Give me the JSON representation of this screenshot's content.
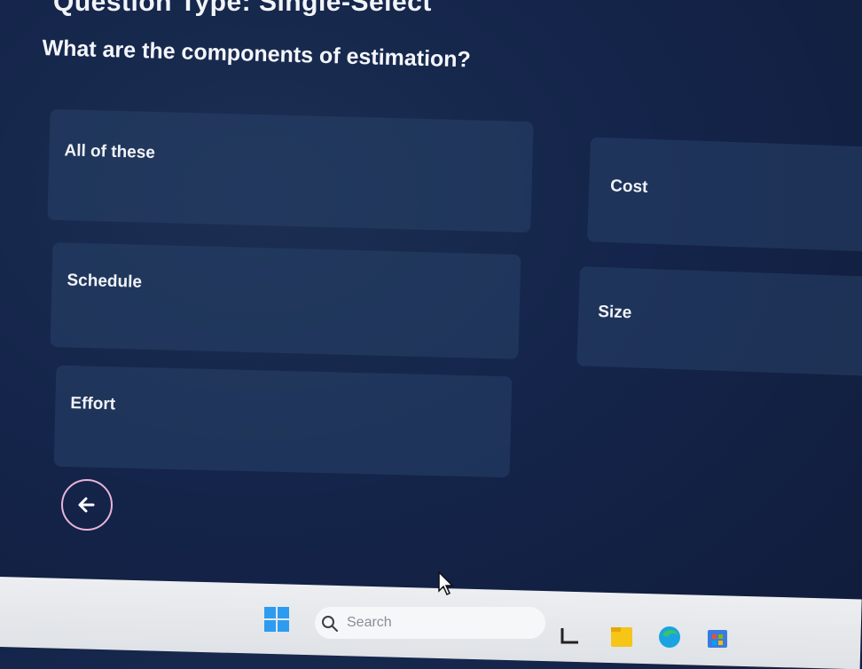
{
  "quiz": {
    "question_type": "Question Type: Single-Select",
    "question": "What are the components of estimation?",
    "options": [
      {
        "label": "All of these"
      },
      {
        "label": "Cost"
      },
      {
        "label": "Schedule"
      },
      {
        "label": "Size"
      },
      {
        "label": "Effort"
      }
    ],
    "back_icon": "arrow-left-icon"
  },
  "taskbar": {
    "search_placeholder": "Search",
    "icons": [
      "windows-start-icon",
      "search-icon",
      "task-view-icon",
      "file-explorer-icon",
      "edge-browser-icon",
      "store-icon"
    ]
  },
  "colors": {
    "background": "#14244a",
    "option_bg": "#284268",
    "back_button_border": "#e9b4d8",
    "windows_blue": "#2d9cf0"
  }
}
